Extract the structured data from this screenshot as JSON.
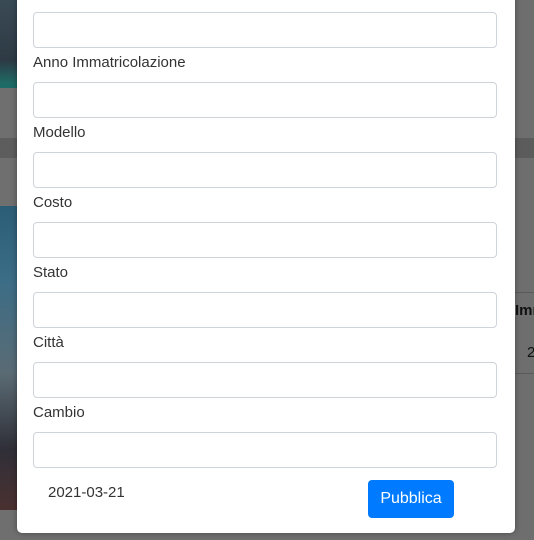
{
  "form": {
    "fields": [
      {
        "label": "",
        "value": "",
        "placeholder": ""
      },
      {
        "label": "Anno Immatricolazione",
        "value": "",
        "placeholder": ""
      },
      {
        "label": "Modello",
        "value": "",
        "placeholder": ""
      },
      {
        "label": "Costo",
        "value": "",
        "placeholder": ""
      },
      {
        "label": "Stato",
        "value": "",
        "placeholder": ""
      },
      {
        "label": "Città",
        "value": "",
        "placeholder": ""
      },
      {
        "label": "Cambio",
        "value": "",
        "placeholder": ""
      }
    ],
    "date": "2021-03-21",
    "submit_label": "Pubblica"
  },
  "background": {
    "table_header_fragment": "Imm",
    "table_cell_fragment": "2"
  },
  "colors": {
    "primary": "#007bff",
    "overlay": "#6f6f6f",
    "input_border": "#ced4da"
  }
}
